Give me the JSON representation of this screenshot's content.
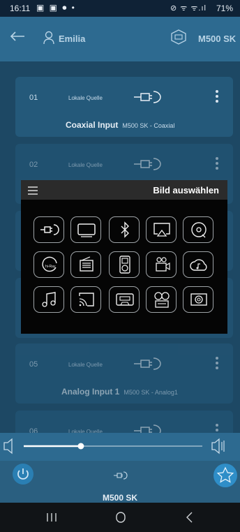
{
  "status_bar": {
    "time": "16:11",
    "left_icons": "▣ ▣ ⏺ •",
    "right_icons": "⊘ ᯤ ᯤ.ıl",
    "battery": "71%"
  },
  "header": {
    "user_name": "Emilia",
    "device_name": "M500 SK"
  },
  "cards": [
    {
      "num": "01",
      "source_type": "Lokale Quelle",
      "name": "Coaxial Input",
      "subtitle": "M500 SK - Coaxial"
    },
    {
      "num": "02",
      "source_type": "Lokale Quelle",
      "name": "",
      "subtitle": ""
    },
    {
      "num": "05",
      "source_type": "Lokale Quelle",
      "name": "Analog Input 1",
      "subtitle": "M500 SK - Analog1"
    },
    {
      "num": "06",
      "source_type": "Lokale Quelle",
      "name": "",
      "subtitle": ""
    }
  ],
  "picker": {
    "title": "Bild auswählen",
    "icons": [
      "plug-icon",
      "tv-icon",
      "bluetooth-icon",
      "airplay-icon",
      "cd-icon",
      "hiray-icon",
      "radio-icon",
      "ipod-icon",
      "projector-icon",
      "cloud-music-icon",
      "music-note-icon",
      "cast-icon",
      "cassette-icon",
      "reel-tape-icon",
      "speaker-icon"
    ],
    "hiray_label": "hi-Ray"
  },
  "volume": {
    "level": 0.32
  },
  "player": {
    "device": "M500 SK"
  },
  "colors": {
    "header": "#2d6a90",
    "list_bg": "#1d4864",
    "card": "#24597a",
    "accent": "#2f8ec8"
  }
}
